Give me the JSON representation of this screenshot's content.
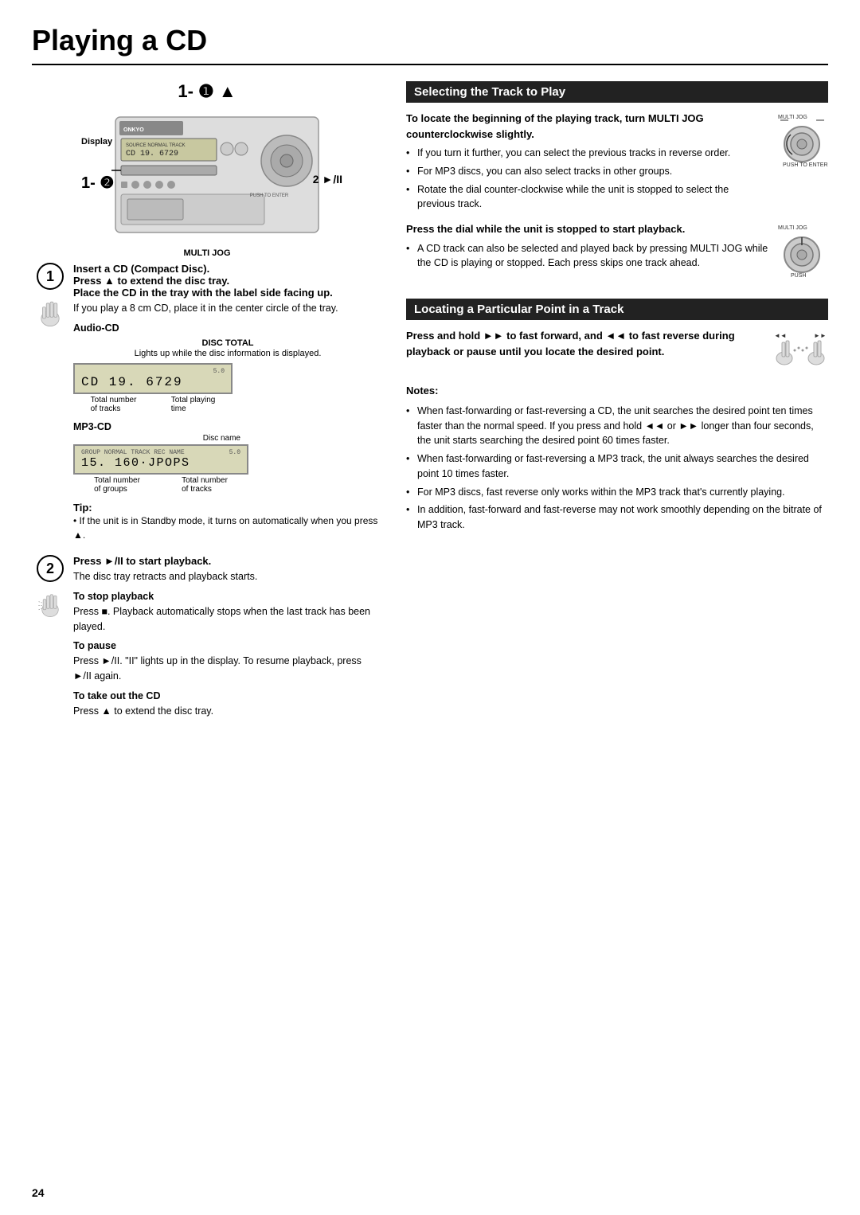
{
  "page": {
    "title": "Playing a CD",
    "number": "24"
  },
  "device_diagram": {
    "label_1": "1- ❶ ▲",
    "label_1_2": "1- ❷",
    "label_2_play": "2 ►/II",
    "display_label": "Display",
    "multijog_label": "MULTI JOG"
  },
  "step1": {
    "number": "1",
    "title": "Insert a CD (Compact Disc).",
    "line2": "Press ▲ to extend the disc tray.",
    "line3": "Place the CD in the tray with the label side facing up.",
    "note": "If you play a 8 cm CD, place it in the center circle of the tray.",
    "audio_cd_label": "Audio-CD",
    "disc_total_label": "DISC TOTAL",
    "disc_total_desc": "Lights up while the disc information is displayed.",
    "lcd1_top": "5.0",
    "lcd1_main": "CD  19. 6729",
    "lcd1_label1": "Total number",
    "lcd1_label2": "of tracks",
    "lcd1_label3": "Total playing",
    "lcd1_label4": "time",
    "mp3_cd_label": "MP3-CD",
    "disc_name_label": "Disc name",
    "lcd2_top": "5.0",
    "lcd2_main": "15. 160·JPOPS",
    "lcd2_label1": "Total number",
    "lcd2_label2": "of groups",
    "lcd2_label3": "Total number",
    "lcd2_label4": "of tracks",
    "tip_title": "Tip:",
    "tip_text": "• If the unit is in Standby mode, it turns on automatically when you press ▲."
  },
  "step2": {
    "number": "2",
    "title": "Press ►/II to start playback.",
    "subtitle_disc": "The disc tray retracts and playback starts.",
    "stop_title": "To stop playback",
    "stop_text": "Press ■. Playback automatically stops when the last track has been played.",
    "pause_title": "To pause",
    "pause_text": "Press ►/II. \"II\" lights up in the display. To resume playback, press ►/II again.",
    "takeout_title": "To take out the CD",
    "takeout_text": "Press ▲ to extend the disc tray."
  },
  "selecting_track": {
    "header": "Selecting the Track to Play",
    "intro": "To locate the beginning of the playing track, turn MULTI JOG counterclockwise slightly.",
    "bullets": [
      "If you turn it further, you can select the previous tracks in reverse order.",
      "For MP3 discs, you can also select tracks in other groups.",
      "Rotate the dial counter-clockwise while the unit is stopped to select the previous track."
    ],
    "press_dial_title": "Press the dial while the unit is stopped to start playback.",
    "press_dial_text": "A CD track can also be selected and played back by pressing MULTI JOG while the CD is playing or stopped. Each press skips one track ahead."
  },
  "locating_track": {
    "header": "Locating a Particular Point in a Track",
    "intro": "Press and hold ►► to fast forward, and ◄◄ to fast reverse during playback or pause until you locate the desired point.",
    "notes_title": "Notes:",
    "notes": [
      "When fast-forwarding or fast-reversing a CD, the unit searches the desired point ten times faster than the normal speed. If you press and hold ◄◄ or ►► longer than four seconds, the unit starts searching the desired point 60 times faster.",
      "When fast-forwarding or fast-reversing a MP3 track, the unit always searches the desired point 10 times faster.",
      "For MP3 discs, fast reverse only works within the MP3 track that's currently playing.",
      "In addition, fast-forward and fast-reverse may not work smoothly depending on the bitrate of MP3 track."
    ]
  }
}
